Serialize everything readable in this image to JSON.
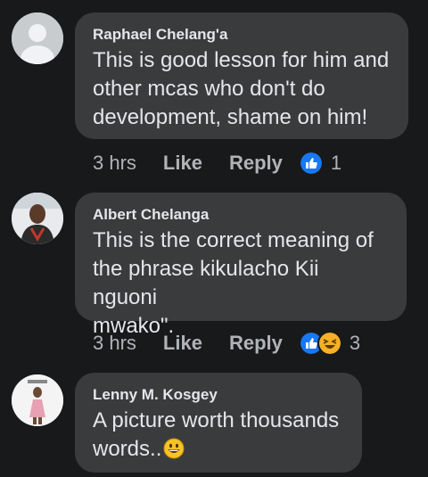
{
  "comments": [
    {
      "author": "Raphael Chelang'a",
      "text": "This is good lesson for him and\nother mcas who don't do\ndevelopment, shame on him!",
      "time": "3 hrs",
      "like_label": "Like",
      "reply_label": "Reply",
      "reactions": [
        "like-reaction-icon"
      ],
      "reaction_count": "1"
    },
    {
      "author": "Albert Chelanga",
      "text": "This is the correct meaning of\nthe phrase kikulacho Kii nguoni\nmwako\".",
      "time": "3 hrs",
      "like_label": "Like",
      "reply_label": "Reply",
      "reactions": [
        "like-reaction-icon",
        "haha-reaction-icon"
      ],
      "reaction_count": "3"
    },
    {
      "author": "Lenny M. Kosgey",
      "text": "A picture worth thousands\nwords..",
      "emoji": "grinning-face-icon"
    }
  ],
  "colors": {
    "background": "#18191a",
    "bubble": "#3a3b3c",
    "like_blue": "#1877f2",
    "haha_yellow": "#f7b125"
  }
}
